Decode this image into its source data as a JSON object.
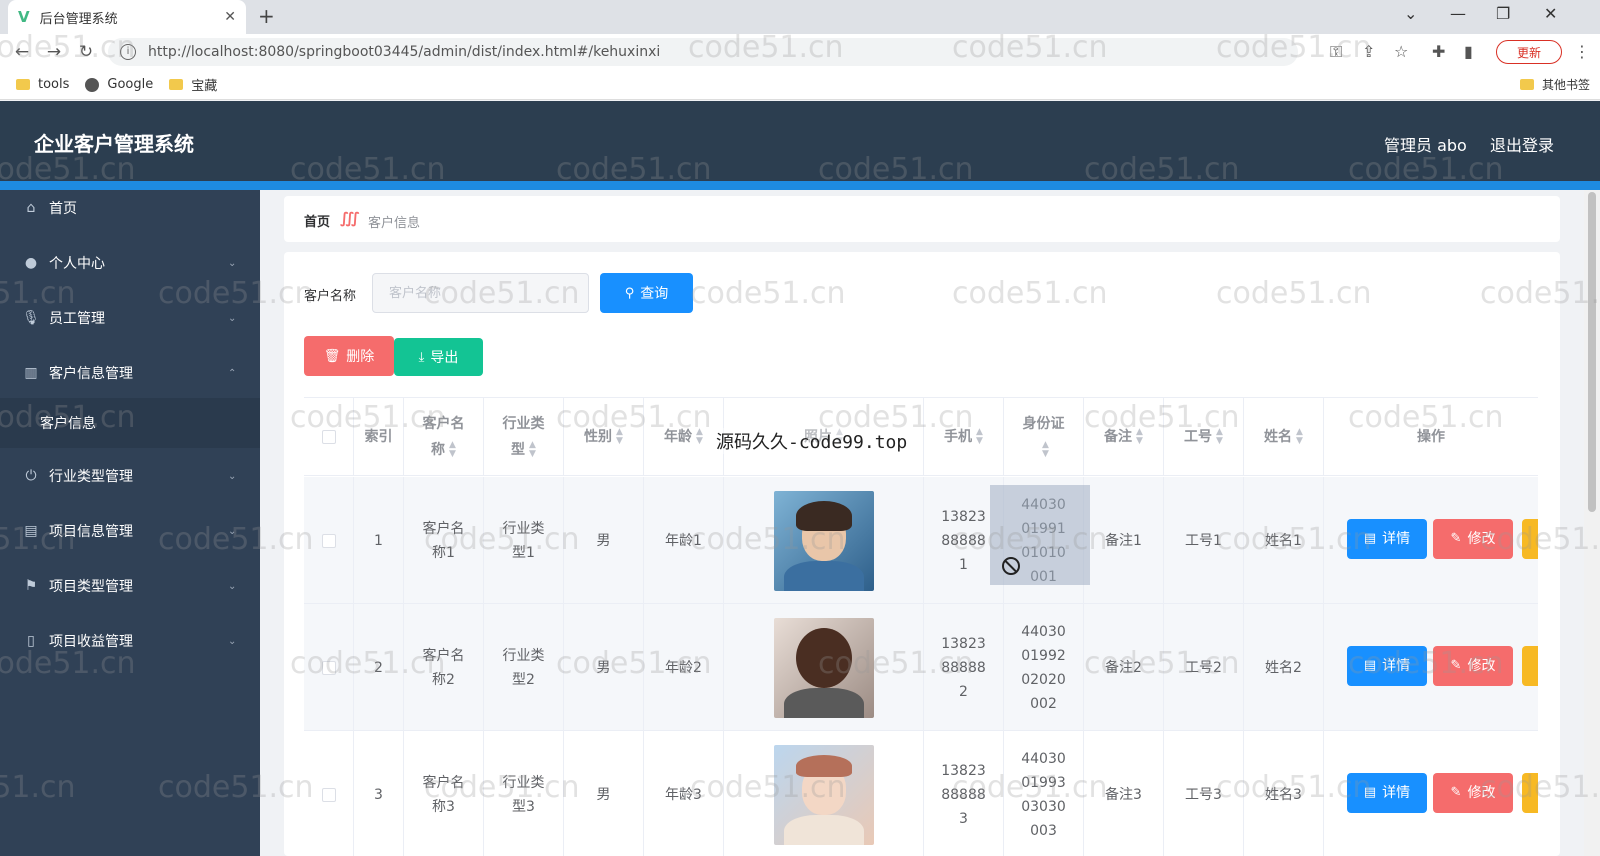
{
  "browser": {
    "tab_title": "后台管理系统",
    "tab_logo": "V",
    "tab_close": "✕",
    "new_tab": "+",
    "window_controls": [
      "⌄",
      "—",
      "❐",
      "✕"
    ],
    "nav_icons": [
      "←",
      "→",
      "↻"
    ],
    "url": "http://localhost:8080/springboot03445/admin/dist/index.html#/kehuxinxi",
    "toolbar_icons": [
      "key-icon",
      "share-icon",
      "star-icon",
      "puzzle-icon",
      "sidepanel-icon",
      "profile-icon",
      "menu-icon"
    ],
    "update_label": "更新",
    "menu_dots": "⋮",
    "bookmarks": [
      {
        "label": "tools",
        "icon": "folder-icon"
      },
      {
        "label": "Google",
        "icon": "globe-icon"
      },
      {
        "label": "宝藏",
        "icon": "folder-icon"
      }
    ],
    "other_bookmarks": "其他书签"
  },
  "header": {
    "title": "企业客户管理系统",
    "user": "管理员 abo",
    "logout": "退出登录",
    "color": "#2c3e50",
    "accent": "#1e8be0"
  },
  "sidebar": {
    "items": [
      {
        "label": "首页",
        "icon": "home-icon",
        "expandable": false
      },
      {
        "label": "个人中心",
        "icon": "user-icon",
        "expandable": true
      },
      {
        "label": "员工管理",
        "icon": "microphone-icon",
        "expandable": true
      },
      {
        "label": "客户信息管理",
        "icon": "chart-icon",
        "expandable": true,
        "open": true
      },
      {
        "label": "行业类型管理",
        "icon": "power-icon",
        "expandable": true
      },
      {
        "label": "项目信息管理",
        "icon": "briefcase-icon",
        "expandable": true
      },
      {
        "label": "项目类型管理",
        "icon": "flag-icon",
        "expandable": true
      },
      {
        "label": "项目收益管理",
        "icon": "phone-icon",
        "expandable": true
      }
    ],
    "submenu": {
      "label": "客户信息"
    }
  },
  "breadcrumb": {
    "home": "首页",
    "separator": "∭",
    "current": "客户信息"
  },
  "search": {
    "label": "客户名称",
    "placeholder": "客户名称",
    "query_button": "查询",
    "query_icon": "🔍"
  },
  "actions": {
    "delete": "删除",
    "delete_icon": "🗑",
    "export": "导出",
    "export_icon": "⤓"
  },
  "table": {
    "headers": [
      "索引",
      "客户名称",
      "行业类型",
      "性别",
      "年龄",
      "照片",
      "手机",
      "身份证",
      "备注",
      "工号",
      "姓名",
      "操作"
    ],
    "rows": [
      {
        "index": "1",
        "name": "客户名称1",
        "industry": "行业类型1",
        "gender": "男",
        "age": "年龄1",
        "phone": "13823888881",
        "idcard": "440300199101010001",
        "note": "备注1",
        "emp_no": "工号1",
        "emp_name": "姓名1"
      },
      {
        "index": "2",
        "name": "客户名称2",
        "industry": "行业类型2",
        "gender": "男",
        "age": "年龄2",
        "phone": "13823888882",
        "idcard": "440300199202020002",
        "note": "备注2",
        "emp_no": "工号2",
        "emp_name": "姓名2"
      },
      {
        "index": "3",
        "name": "客户名称3",
        "industry": "行业类型3",
        "gender": "男",
        "age": "年龄3",
        "phone": "13823888883",
        "idcard": "440300199303030003",
        "note": "备注3",
        "emp_no": "工号3",
        "emp_name": "姓名3"
      }
    ],
    "row_actions": {
      "detail": "详情",
      "detail_icon": "▤",
      "edit": "修改",
      "edit_icon": "✎"
    }
  },
  "watermark": {
    "text": "code51.cn",
    "center_text": "源码久久-code99.top"
  },
  "colors": {
    "primary": "#1890ff",
    "danger": "#f56c6c",
    "success": "#13c494",
    "warning": "#f7b924"
  }
}
